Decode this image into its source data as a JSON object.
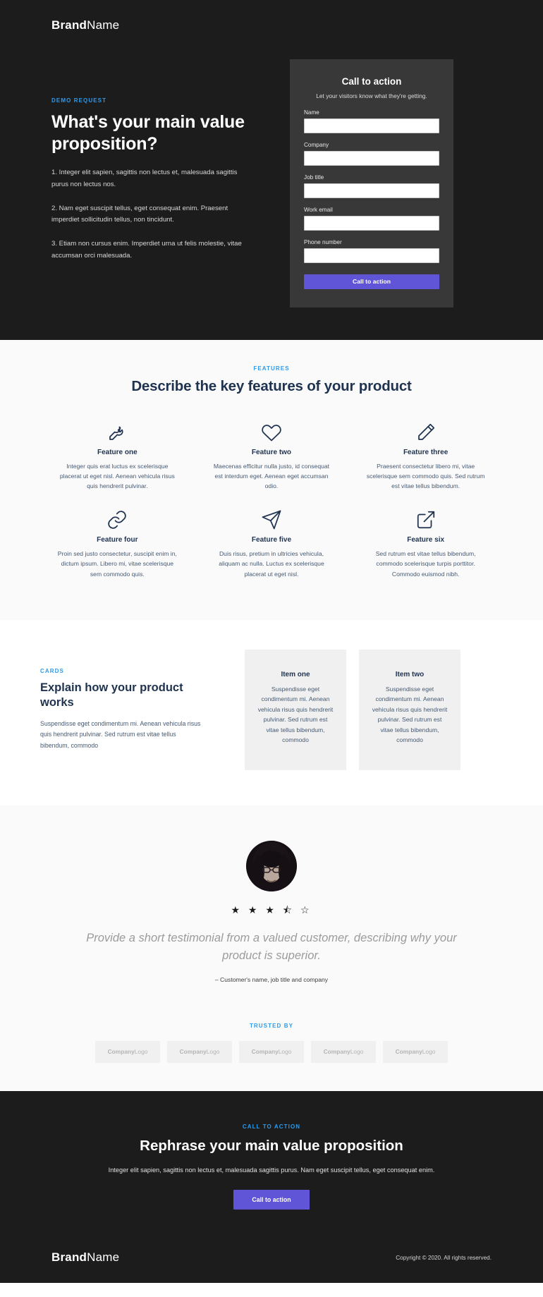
{
  "hero": {
    "brand_bold": "Brand",
    "brand_light": "Name",
    "eyebrow": "DEMO REQUEST",
    "heading": "What's your main value proposition?",
    "paragraphs": [
      "1. Integer elit sapien, sagittis non lectus et, malesuada sagittis purus non lectus nos.",
      "2. Nam eget suscipit tellus, eget consequat enim. Praesent imperdiet sollicitudin tellus, non tincidunt.",
      "3. Etiam non cursus enim. Imperdiet urna ut felis molestie, vitae accumsan orci malesuada."
    ],
    "form": {
      "title": "Call to action",
      "subtitle": "Let your visitors know what they're getting.",
      "fields": [
        {
          "label": "Name",
          "value": "",
          "placeholder": ""
        },
        {
          "label": "Company",
          "value": "",
          "placeholder": ""
        },
        {
          "label": "Job title",
          "value": "",
          "placeholder": ""
        },
        {
          "label": "Work email",
          "value": "",
          "placeholder": ""
        },
        {
          "label": "Phone number",
          "value": "",
          "placeholder": ""
        }
      ],
      "submit_label": "Call to action",
      "accent_color": "#5f55d6"
    }
  },
  "features": {
    "eyebrow": "FEATURES",
    "heading": "Describe the key features of your product",
    "items": [
      {
        "icon": "wrench-icon",
        "title": "Feature one",
        "desc": "Integer quis erat luctus ex scelerisque placerat ut eget nisl. Aenean vehicula risus quis hendrerit pulvinar."
      },
      {
        "icon": "heart-icon",
        "title": "Feature two",
        "desc": "Maecenas efficitur nulla justo, id consequat est interdum eget. Aenean eget accumsan odio."
      },
      {
        "icon": "pen-icon",
        "title": "Feature three",
        "desc": "Praesent consectetur libero mi, vitae scelerisque sem commodo quis. Sed rutrum est vitae tellus bibendum."
      },
      {
        "icon": "link-icon",
        "title": "Feature four",
        "desc": "Proin sed justo consectetur, suscipit enim in, dictum ipsum. Libero mi, vitae scelerisque sem commodo quis."
      },
      {
        "icon": "send-icon",
        "title": "Feature five",
        "desc": "Duis risus, pretium in ultricies vehicula, aliquam ac nulla. Luctus ex scelerisque placerat ut eget nisl."
      },
      {
        "icon": "external-link-icon",
        "title": "Feature six",
        "desc": "Sed rutrum est vitae tellus bibendum, commodo scelerisque turpis porttitor. Commodo euismod nibh."
      }
    ]
  },
  "cards": {
    "eyebrow": "CARDS",
    "heading": "Explain how your product works",
    "paragraph": "Suspendisse eget condimentum mi. Aenean vehicula risus quis hendrerit pulvinar. Sed rutrum est vitae tellus bibendum, commodo",
    "items": [
      {
        "title": "Item one",
        "text": "Suspendisse eget condimentum mi. Aenean vehicula risus quis hendrerit pulvinar. Sed rutrum est vitae tellus bibendum, commodo"
      },
      {
        "title": "Item two",
        "text": "Suspendisse eget condimentum mi. Aenean vehicula risus quis hendrerit pulvinar. Sed rutrum est vitae tellus bibendum, commodo"
      }
    ]
  },
  "testimonial": {
    "rating": 3.5,
    "stars_display": "★ ★ ★ ⯪ ☆",
    "quote": "Provide a short testimonial from a valued customer, describing why your product is superior.",
    "attribution": "– Customer's name, job title and company"
  },
  "trusted": {
    "eyebrow": "TRUSTED BY",
    "logos": [
      {
        "bold": "Company",
        "light": "Logo"
      },
      {
        "bold": "Company",
        "light": "Logo"
      },
      {
        "bold": "Company",
        "light": "Logo"
      },
      {
        "bold": "Company",
        "light": "Logo"
      },
      {
        "bold": "Company",
        "light": "Logo"
      }
    ]
  },
  "final_cta": {
    "eyebrow": "CALL TO ACTION",
    "heading": "Rephrase your main value proposition",
    "paragraph": "Integer elit sapien, sagittis non lectus et, malesuada sagittis purus. Nam eget suscipit tellus, eget consequat enim.",
    "button_label": "Call to action"
  },
  "footer": {
    "brand_bold": "Brand",
    "brand_light": "Name",
    "copyright": "Copyright © 2020. All rights reserved."
  }
}
